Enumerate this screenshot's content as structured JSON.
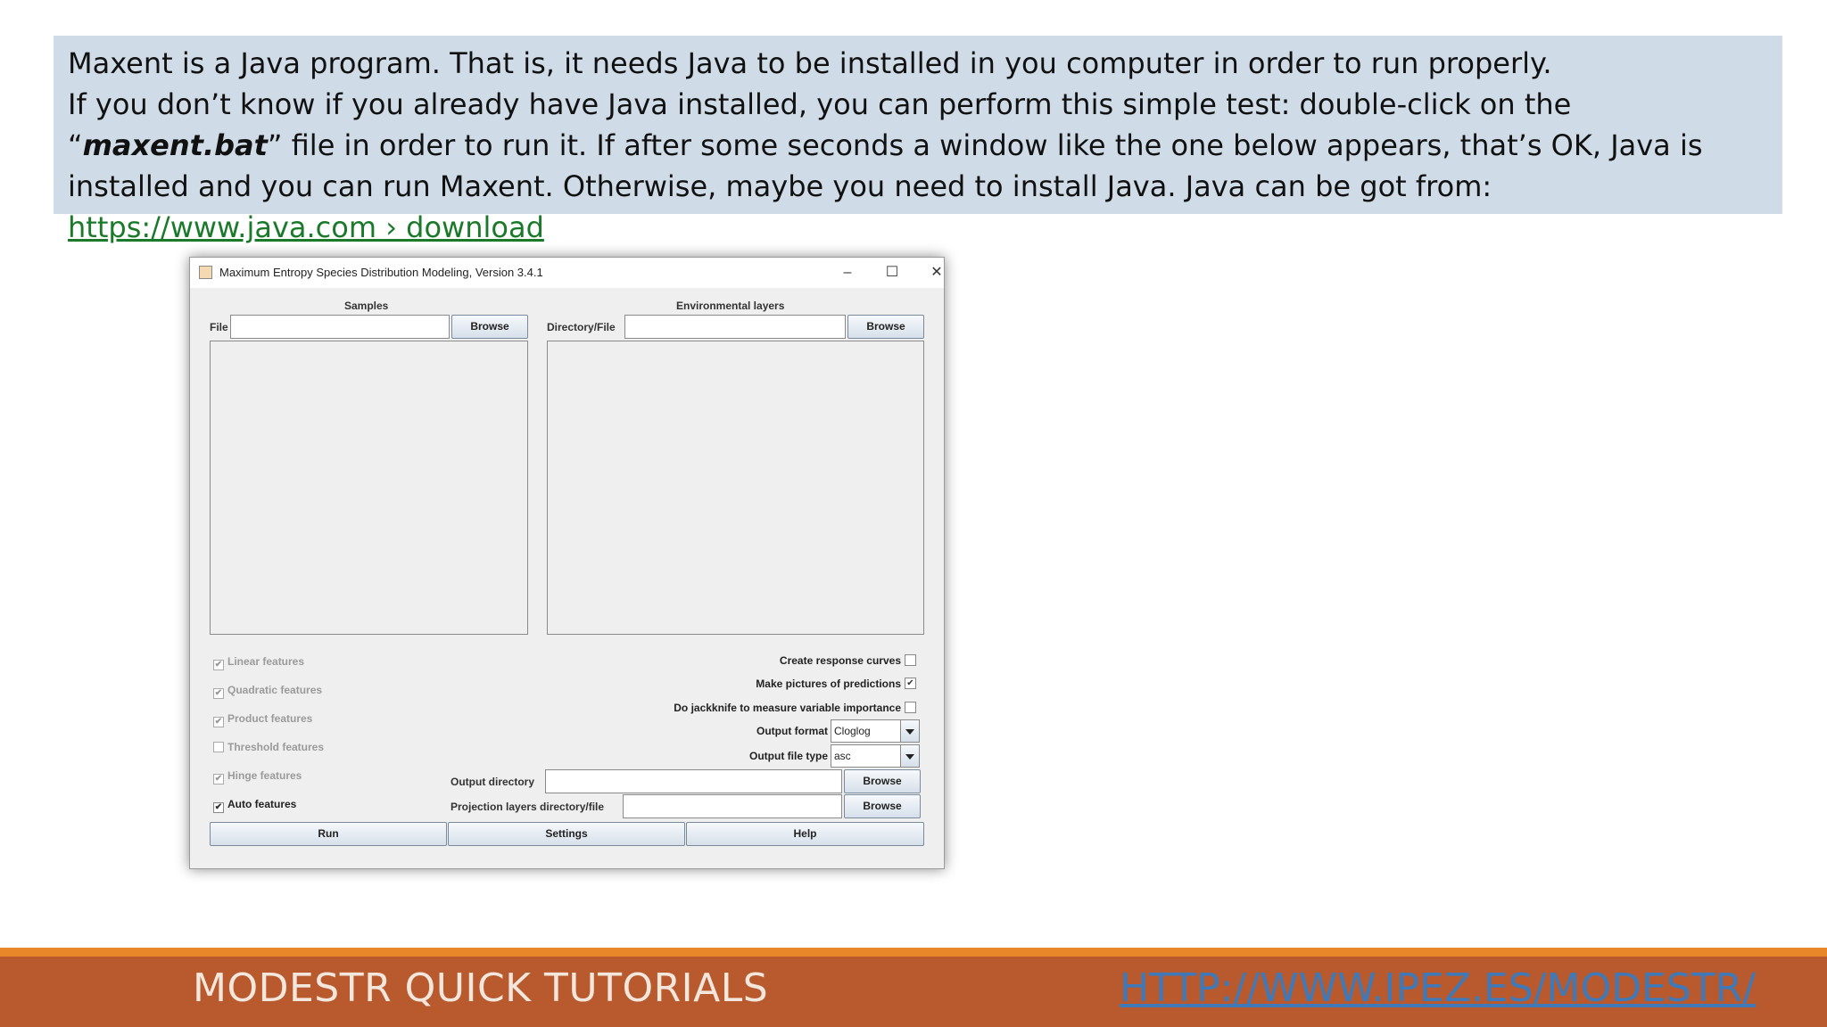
{
  "intro": {
    "line1": "Maxent is a Java program. That is, it needs Java to be installed in you computer in order to run properly.",
    "line2_start": "If you don’t know if you already have Java installed, you can perform this simple test: double-click on the “",
    "line2_bold": "maxent.bat",
    "line2_end": "” file in order to run it. If after some seconds a window like the one below appears, that’s OK, Java is installed and you can run Maxent. Otherwise, maybe you need to install Java. Java can be got from: ",
    "link": "https://www.java.com › download"
  },
  "window": {
    "title": "Maximum Entropy Species Distribution Modeling, Version 3.4.1",
    "minimize": "–",
    "maximize": "☐",
    "close": "✕",
    "samples": {
      "header": "Samples",
      "label": "File",
      "value": "",
      "browse": "Browse"
    },
    "env": {
      "header": "Environmental layers",
      "label": "Directory/File",
      "value": "",
      "browse": "Browse"
    },
    "features": [
      {
        "label": "Linear features",
        "checked": true,
        "enabled": false
      },
      {
        "label": "Quadratic features",
        "checked": true,
        "enabled": false
      },
      {
        "label": "Product features",
        "checked": true,
        "enabled": false
      },
      {
        "label": "Threshold features",
        "checked": false,
        "enabled": false
      },
      {
        "label": "Hinge features",
        "checked": true,
        "enabled": false
      },
      {
        "label": "Auto features",
        "checked": true,
        "enabled": true
      }
    ],
    "options": {
      "response_curves": "Create response curves",
      "response_curves_checked": false,
      "pictures": "Make pictures of predictions",
      "pictures_checked": true,
      "jackknife": "Do jackknife to measure variable importance",
      "jackknife_checked": false,
      "output_format_label": "Output format",
      "output_format_value": "Cloglog",
      "output_file_type_label": "Output file type",
      "output_file_type_value": "asc"
    },
    "output_directory": {
      "label": "Output directory",
      "value": "",
      "browse": "Browse"
    },
    "projection": {
      "label": "Projection layers directory/file",
      "value": "",
      "browse": "Browse"
    },
    "buttons": {
      "run": "Run",
      "settings": "Settings",
      "help": "Help"
    },
    "check_mark": "✔"
  },
  "footer": {
    "title": "MODESTR QUICK TUTORIALS",
    "link": "HTTP://WWW.IPEZ.ES/MODESTR/"
  },
  "colors": {
    "intro_bg": "#cfdce7",
    "footer_bg": "#b85a2d",
    "footer_accent": "#e8862a",
    "link_green": "#1a7a2a",
    "link_blue": "#3f79b8"
  }
}
